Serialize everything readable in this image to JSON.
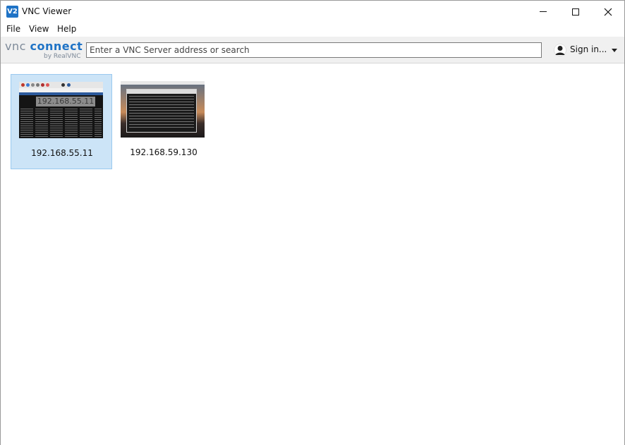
{
  "window": {
    "title": "VNC Viewer",
    "app_icon_text": "V2"
  },
  "menu": {
    "file": "File",
    "view": "View",
    "help": "Help"
  },
  "toolbar": {
    "logo_vnc": "vnc",
    "logo_connect": "connect",
    "logo_sub": "by RealVNC",
    "search_placeholder": "Enter a VNC Server address or search",
    "sign_in_label": "Sign in..."
  },
  "connections": [
    {
      "label": "192.168.55.11",
      "overlay_text": "192.168.55.11",
      "selected": true
    },
    {
      "label": "192.168.59.130",
      "selected": false
    }
  ],
  "colors": {
    "brand_blue": "#1f73c6",
    "selection": "#cce4f7"
  }
}
